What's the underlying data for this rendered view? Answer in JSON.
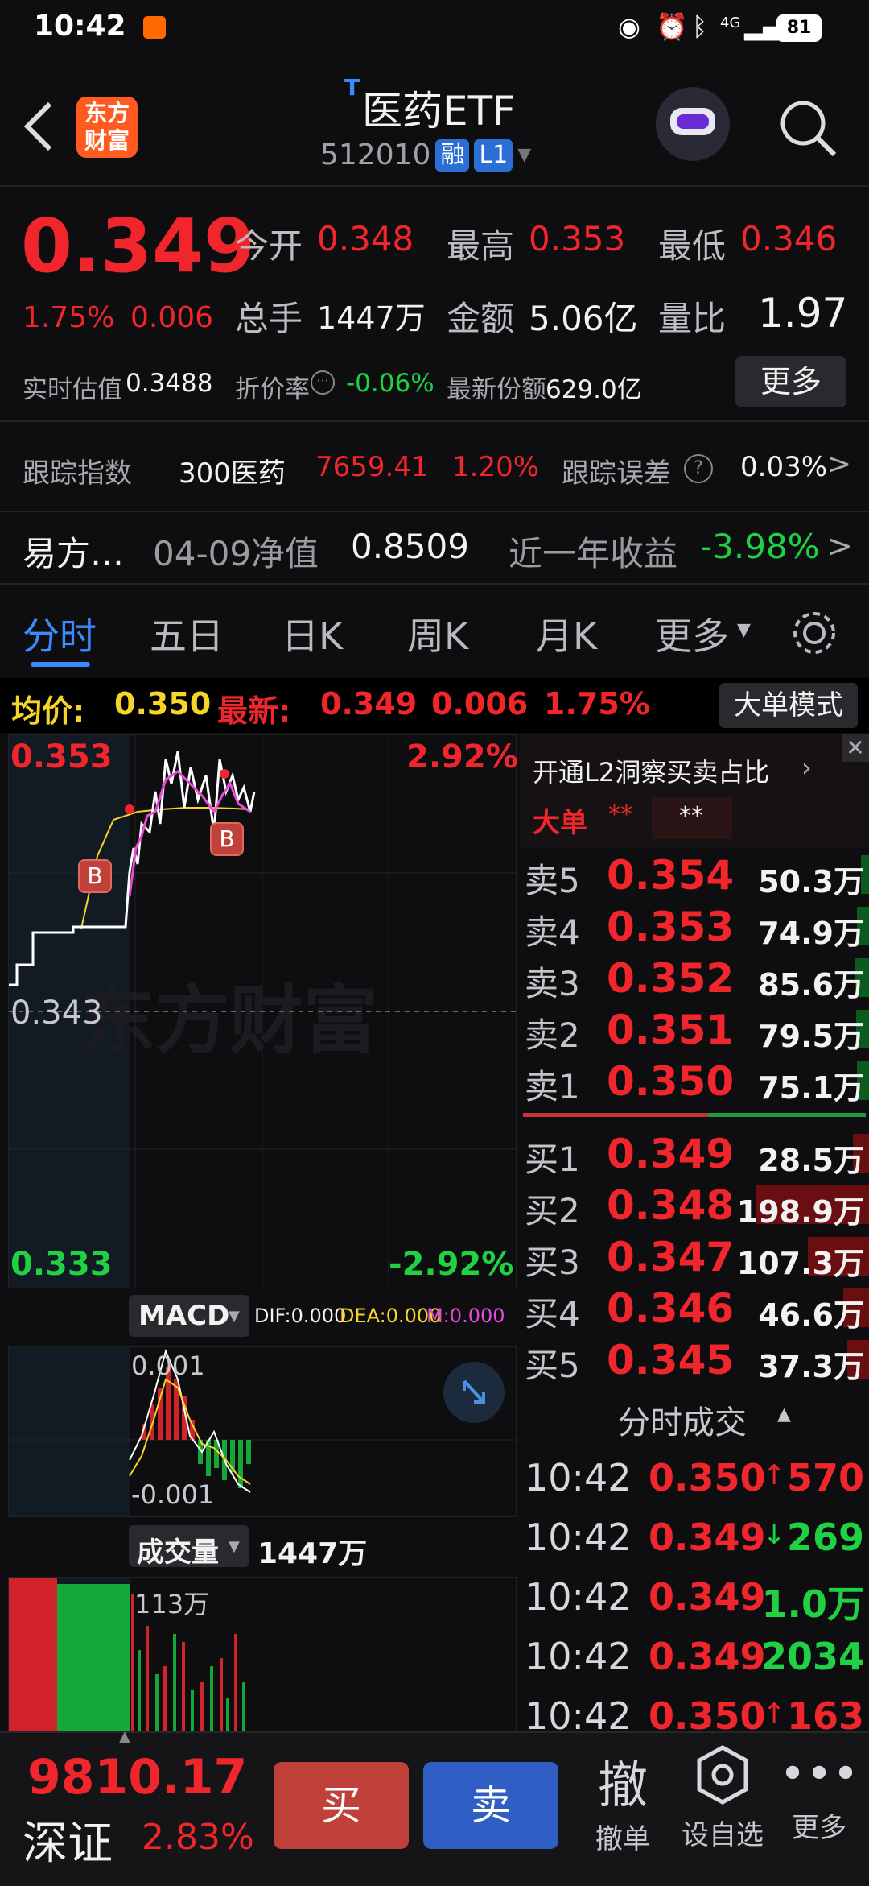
{
  "status_bar": {
    "time": "10:42",
    "network": "4G",
    "battery": "81"
  },
  "header": {
    "title": "医药ETF",
    "title_prefix": "T",
    "code": "512010",
    "tag_margin": "融",
    "tag_level": "L1",
    "logo_line1": "东方",
    "logo_line2": "财富"
  },
  "quote": {
    "price": "0.349",
    "change_pct": "1.75%",
    "change_amt": "0.006",
    "open_label": "今开",
    "open": "0.348",
    "high_label": "最高",
    "high": "0.353",
    "low_label": "最低",
    "low": "0.346",
    "vol_label": "总手",
    "vol": "1447万",
    "amount_label": "金额",
    "amount": "5.06亿",
    "ratio_label": "量比",
    "ratio": "1.97",
    "iopv_label": "实时估值",
    "iopv": "0.3488",
    "premium_label": "折价率",
    "premium": "-0.06%",
    "shares_label": "最新份额",
    "shares": "629.0亿",
    "more_button": "更多"
  },
  "tracking": {
    "label": "跟踪指数",
    "index_name": "300医药",
    "index_value": "7659.41",
    "index_pct": "1.20%",
    "error_label": "跟踪误差",
    "error_value": "0.03%"
  },
  "fund": {
    "name": "易方…",
    "nav_label": "04-09净值",
    "nav": "0.8509",
    "yield_label": "近一年收益",
    "yield": "-3.98%"
  },
  "tabs": [
    "分时",
    "五日",
    "日K",
    "周K",
    "月K",
    "更多"
  ],
  "info_bar": {
    "avg_label": "均价:",
    "avg": "0.350",
    "latest_label": "最新:",
    "latest": "0.349",
    "chg": "0.006",
    "pct": "1.75%",
    "mode_button": "大单模式"
  },
  "chart_labels": {
    "top_price": "0.353",
    "top_pct": "2.92%",
    "mid_price": "0.343",
    "bottom_price": "0.333",
    "bottom_pct": "-2.92%",
    "marker_b": "B",
    "watermark": "东方财富"
  },
  "macd": {
    "selector": "MACD",
    "dif": "DIF:0.000",
    "dea": "DEA:0.000",
    "m": "M:0.000",
    "top": "0.001",
    "bottom": "-0.001"
  },
  "volume": {
    "selector": "成交量",
    "total": "1447万",
    "max_label": "113万"
  },
  "orderbook": {
    "promo": "开通L2洞察买卖占比",
    "big_label": "大单",
    "stars1": "**",
    "stars2": "**",
    "asks": [
      {
        "label": "卖5",
        "price": "0.354",
        "vol": "50.3万",
        "ratio": 0.25
      },
      {
        "label": "卖4",
        "price": "0.353",
        "vol": "74.9万",
        "ratio": 0.38
      },
      {
        "label": "卖3",
        "price": "0.352",
        "vol": "85.6万",
        "ratio": 0.43
      },
      {
        "label": "卖2",
        "price": "0.351",
        "vol": "79.5万",
        "ratio": 0.4
      },
      {
        "label": "卖1",
        "price": "0.350",
        "vol": "75.1万",
        "ratio": 0.38
      }
    ],
    "bids": [
      {
        "label": "买1",
        "price": "0.349",
        "vol": "28.5万",
        "ratio": 0.14
      },
      {
        "label": "买2",
        "price": "0.348",
        "vol": "198.9万",
        "ratio": 1.0
      },
      {
        "label": "买3",
        "price": "0.347",
        "vol": "107.3万",
        "ratio": 0.54
      },
      {
        "label": "买4",
        "price": "0.346",
        "vol": "46.6万",
        "ratio": 0.23
      },
      {
        "label": "买5",
        "price": "0.345",
        "vol": "37.3万",
        "ratio": 0.19
      }
    ]
  },
  "ticks": {
    "title": "分时成交",
    "rows": [
      {
        "time": "10:42",
        "price": "0.350",
        "arrow": "↑",
        "vol": "570",
        "color": "red"
      },
      {
        "time": "10:42",
        "price": "0.349",
        "arrow": "↓",
        "vol": "269",
        "color": "green"
      },
      {
        "time": "10:42",
        "price": "0.349",
        "arrow": "",
        "vol": "1.0万",
        "color": "green"
      },
      {
        "time": "10:42",
        "price": "0.349",
        "arrow": "",
        "vol": "2034",
        "color": "green"
      },
      {
        "time": "10:42",
        "price": "0.350",
        "arrow": "↑",
        "vol": "163",
        "color": "red"
      }
    ]
  },
  "bottom": {
    "index_value": "9810.17",
    "index_name": "深证",
    "index_pct": "2.83%",
    "buy": "买",
    "sell": "卖",
    "cancel_glyph": "撤",
    "cancel": "撤单",
    "watchlist": "设自选",
    "more": "更多"
  },
  "colors": {
    "up": "#f0262c",
    "down": "#1fd143",
    "avg_line": "#f7d428",
    "price_line": "#ffffff",
    "bg": "#0e0e10"
  }
}
